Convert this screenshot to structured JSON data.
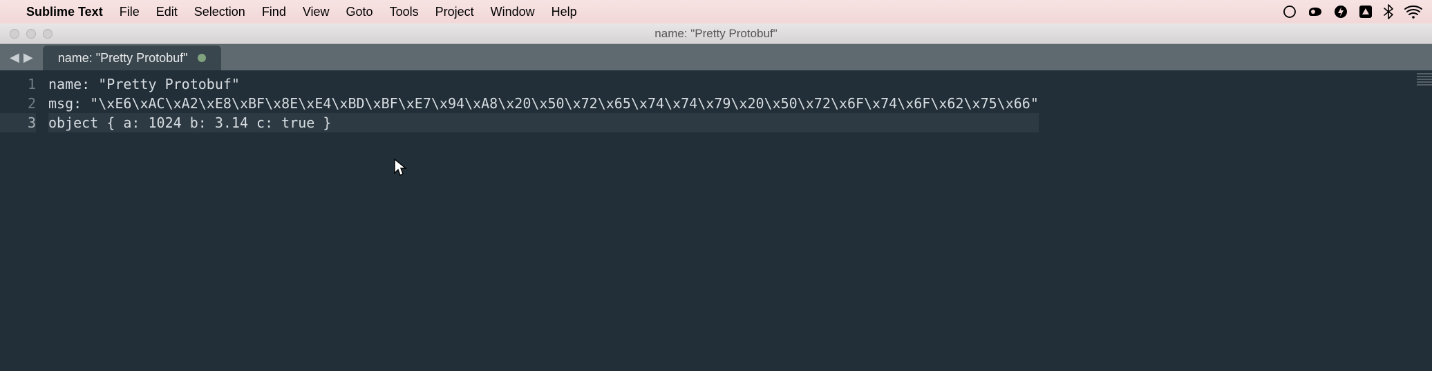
{
  "menubar": {
    "appname": "Sublime Text",
    "items": [
      "File",
      "Edit",
      "Selection",
      "Find",
      "View",
      "Goto",
      "Tools",
      "Project",
      "Window",
      "Help"
    ]
  },
  "window": {
    "title": "name: \"Pretty Protobuf\""
  },
  "tab": {
    "label": "name: \"Pretty Protobuf\"",
    "dirty": true
  },
  "editor": {
    "current_line_index": 2,
    "lines": [
      "name: \"Pretty Protobuf\"",
      "msg: \"\\xE6\\xAC\\xA2\\xE8\\xBF\\x8E\\xE4\\xBD\\xBF\\xE7\\x94\\xA8\\x20\\x50\\x72\\x65\\x74\\x74\\x79\\x20\\x50\\x72\\x6F\\x74\\x6F\\x62\\x75\\x66\"",
      "object { a: 1024 b: 3.14 c: true }"
    ]
  }
}
